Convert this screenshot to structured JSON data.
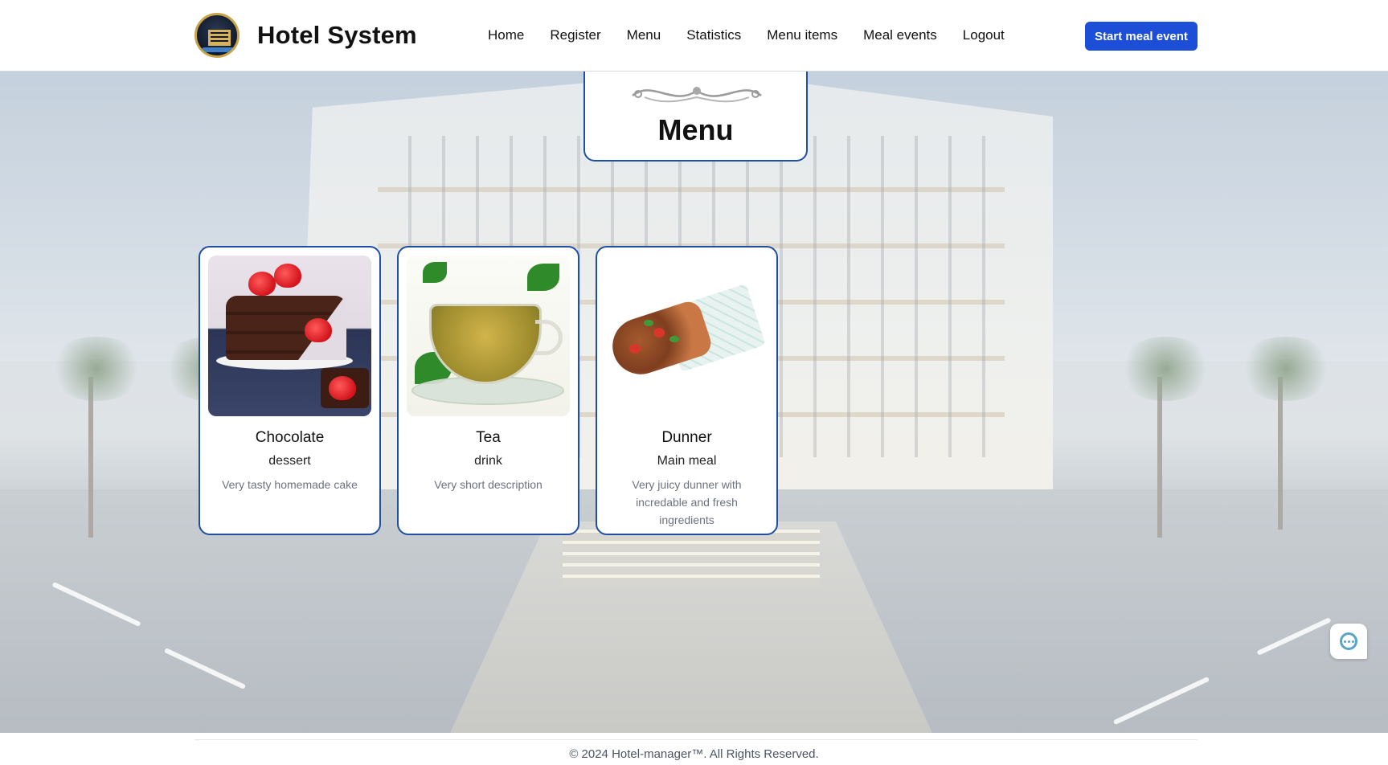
{
  "brand": {
    "title": "Hotel System",
    "logo": "hotel-logo"
  },
  "nav": {
    "items": [
      {
        "label": "Home"
      },
      {
        "label": "Register"
      },
      {
        "label": "Menu"
      },
      {
        "label": "Statistics"
      },
      {
        "label": "Menu items"
      },
      {
        "label": "Meal events"
      },
      {
        "label": "Logout"
      }
    ]
  },
  "header": {
    "cta_label": "Start meal event",
    "cta_color": "#1d4ed8"
  },
  "menu": {
    "title": "Menu",
    "accent_color": "#1e4fa3",
    "items": [
      {
        "name": "Chocolate",
        "category": "dessert",
        "description": "Very tasty homemade cake",
        "image": "chocolate-cake-image"
      },
      {
        "name": "Tea",
        "category": "drink",
        "description": "Very short description",
        "image": "tea-cup-image"
      },
      {
        "name": "Dunner",
        "category": "Main meal",
        "description": "Very juicy dunner with incredable and fresh ingredients",
        "image": "doner-wrap-image"
      }
    ]
  },
  "chat": {
    "icon": "chat-icon"
  },
  "footer": {
    "copyright": "© 2024 Hotel-manager™. All Rights Reserved."
  }
}
